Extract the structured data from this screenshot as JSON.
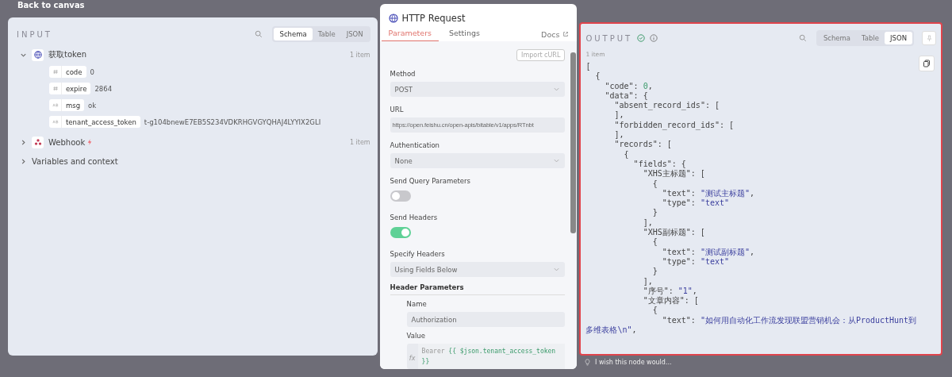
{
  "top_bar": {
    "back_link": "Back to canvas"
  },
  "input": {
    "title": "INPUT",
    "view_tabs": [
      {
        "label": "Schema",
        "selected": true
      },
      {
        "label": "Table",
        "selected": false
      },
      {
        "label": "JSON",
        "selected": false
      }
    ],
    "nodes": [
      {
        "name": "获取token",
        "kind": "http",
        "expanded": true,
        "count": "1 item",
        "fields": [
          {
            "kind": "number",
            "name": "code",
            "value": "0"
          },
          {
            "kind": "number",
            "name": "expire",
            "value": "2864"
          },
          {
            "kind": "string",
            "name": "msg",
            "value": "ok"
          },
          {
            "kind": "string",
            "name": "tenant_access_token",
            "value": "t-g104bnewE7EB5S234VDKRHGVGYQHAJ4LYYIX2GLI"
          }
        ]
      },
      {
        "name": "Webhook",
        "kind": "webhook",
        "expanded": false,
        "count": "1 item"
      }
    ],
    "variables": {
      "label": "Variables and context",
      "expanded": false
    }
  },
  "node": {
    "title": "HTTP Request",
    "tabs": [
      {
        "label": "Parameters",
        "selected": true
      },
      {
        "label": "Settings",
        "selected": false
      }
    ],
    "docs": "Docs",
    "import_button": "Import cURL",
    "params": [
      {
        "kind": "select",
        "label": "Method",
        "value": "POST"
      },
      {
        "kind": "text",
        "label": "URL",
        "value": "https://open.feishu.cn/open-apis/bitable/v1/apps/RTnbt"
      },
      {
        "kind": "select",
        "label": "Authentication",
        "value": "None"
      },
      {
        "kind": "toggle",
        "label": "Send Query Parameters",
        "on": false
      },
      {
        "kind": "toggle",
        "label": "Send Headers",
        "on": true
      },
      {
        "kind": "select",
        "label": "Specify Headers",
        "value": "Using Fields Below"
      }
    ],
    "header_section": "Header Parameters",
    "name_label": "Name",
    "name_value": "Authorization",
    "value_label": "Value",
    "fx": "fx",
    "expr_prefix": "Bearer ",
    "expr": "{{ $json.tenant_access_token",
    "expr_end": "}}"
  },
  "output": {
    "title": "OUTPUT",
    "view_tabs": [
      {
        "label": "Schema",
        "selected": false
      },
      {
        "label": "Table",
        "selected": false
      },
      {
        "label": "JSON",
        "selected": true
      }
    ],
    "count": "1 item",
    "lines": [
      {
        "key": "["
      },
      {
        "key": "  {"
      },
      {
        "key": "    \"code\": ",
        "value": "0",
        "kind": "number",
        "post": ","
      },
      {
        "key": "    \"data\": {"
      },
      {
        "key": "      \"absent_record_ids\": ["
      },
      {
        "key": "      ],"
      },
      {
        "key": "      \"forbidden_record_ids\": ["
      },
      {
        "key": "      ],"
      },
      {
        "key": "      \"records\": ["
      },
      {
        "key": "        {"
      },
      {
        "key": "          \"fields\": {"
      },
      {
        "key": "            \"XHS主标题\": ["
      },
      {
        "key": "              {"
      },
      {
        "key": "                \"text\": ",
        "value": "\"测试主标题\"",
        "kind": "string",
        "post": ","
      },
      {
        "key": "                \"type\": ",
        "value": "\"text\"",
        "kind": "string"
      },
      {
        "key": "              }"
      },
      {
        "key": "            ],"
      },
      {
        "key": "            \"XHS副标题\": ["
      },
      {
        "key": "              {"
      },
      {
        "key": "                \"text\": ",
        "value": "\"测试副标题\"",
        "kind": "string",
        "post": ","
      },
      {
        "key": "                \"type\": ",
        "value": "\"text\"",
        "kind": "string"
      },
      {
        "key": "              }"
      },
      {
        "key": "            ],"
      },
      {
        "key": "            \"序号\": ",
        "value": "\"1\"",
        "kind": "string",
        "post": ","
      },
      {
        "key": "            \"文章内容\": ["
      },
      {
        "key": "              {"
      },
      {
        "key": "                \"text\": ",
        "value": "\"如何用自动化工作流发现联盟营销机会：从ProductHunt到多维表格\\n\"",
        "kind": "string",
        "post": ","
      }
    ]
  },
  "feedback": "I wish this node would..."
}
